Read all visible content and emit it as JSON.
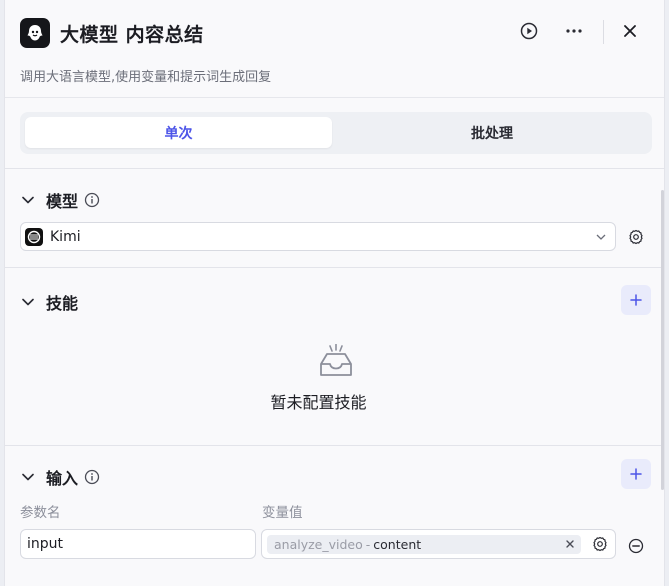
{
  "header": {
    "title": "大模型 内容总结",
    "description": "调用大语言模型,使用变量和提示词生成回复"
  },
  "tabs": [
    {
      "label": "单次",
      "active": true
    },
    {
      "label": "批处理",
      "active": false
    }
  ],
  "model_section": {
    "title": "模型",
    "selected_model": "Kimi"
  },
  "skills_section": {
    "title": "技能",
    "empty_text": "暂未配置技能"
  },
  "input_section": {
    "title": "输入",
    "col_name_label": "参数名",
    "col_value_label": "变量值",
    "rows": [
      {
        "name": "input",
        "var_node": "analyze_video",
        "var_sep": "-",
        "var_key": "content"
      }
    ]
  },
  "colors": {
    "accent": "#4c54e8",
    "accent_soft": "#e9ebfb"
  },
  "icons": [
    "llm-node-icon",
    "run-icon",
    "more-icon",
    "close-icon",
    "chevron-down-icon",
    "info-icon",
    "kimi-logo-icon",
    "settings-icon",
    "plus-icon",
    "empty-box-icon",
    "tag-close-icon",
    "remove-icon"
  ]
}
